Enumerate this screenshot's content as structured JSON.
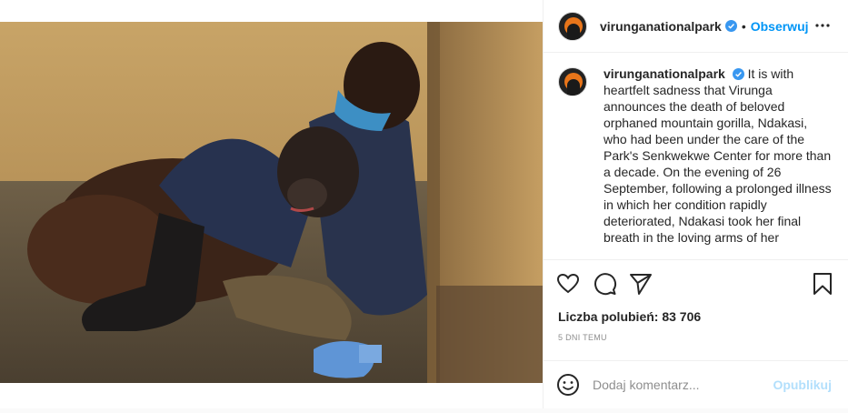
{
  "account": {
    "username": "virunganationalpark",
    "verified": true,
    "dot": "•",
    "follow_label": "Obserwuj"
  },
  "caption": {
    "username": "virunganationalpark",
    "text": "It is with heartfelt sadness that Virunga announces the death of beloved orphaned mountain gorilla, Ndakasi, who had been under the care of the Park's Senkwekwe Center for more than a decade. On the evening of 26 September, following a prolonged illness in which her condition rapidly deteriorated, Ndakasi took her final breath in the loving arms of her"
  },
  "stats": {
    "likes": "Liczba polubień: 83 706",
    "time": "5 DNI TEMU"
  },
  "comment": {
    "placeholder": "Dodaj komentarz...",
    "post_label": "Opublikuj"
  },
  "colors": {
    "link_blue": "#0095f6",
    "post_disabled": "#b2dffc",
    "verified_blue": "#3897f0"
  },
  "icons": {
    "header_more": "more-options-icon",
    "like": "heart-icon",
    "comment": "comment-bubble-icon",
    "share": "paper-plane-icon",
    "save": "bookmark-icon",
    "emoji": "emoji-smile-icon"
  }
}
